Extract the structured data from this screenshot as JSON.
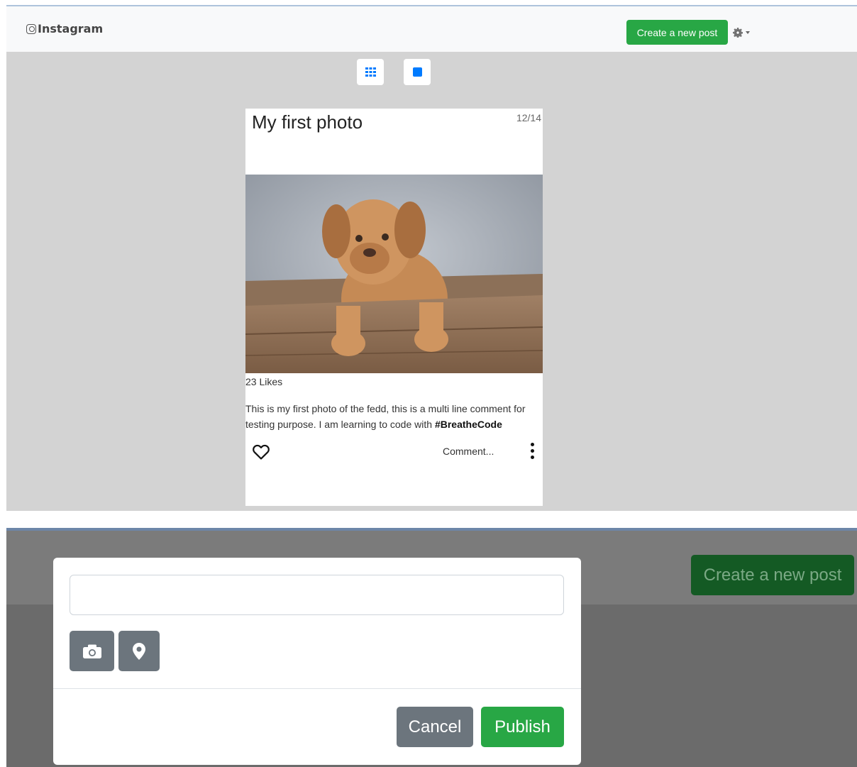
{
  "navbar": {
    "brand": "Instagram",
    "create_button": "Create a new post"
  },
  "post": {
    "title": "My first photo",
    "counter": "12/14",
    "likes": "23 Likes",
    "caption_text": "This is my first photo of the fedd, this is a multi line comment for testing purpose. I am learning to code with ",
    "caption_hashtag": "#BreatheCode",
    "comment_label": "Comment..."
  },
  "modal": {
    "input_value": "",
    "cancel_label": "Cancel",
    "publish_label": "Publish",
    "background_create_button": "Create a new post"
  },
  "icons": [
    "instagram-icon",
    "gear-icon",
    "grid-view-icon",
    "single-view-icon",
    "heart-icon",
    "more-vertical-icon",
    "camera-icon",
    "location-pin-icon"
  ],
  "colors": {
    "success": "#28a745",
    "primary": "#007bff",
    "secondary": "#6c757d",
    "backdrop": "#d3d3d3"
  }
}
